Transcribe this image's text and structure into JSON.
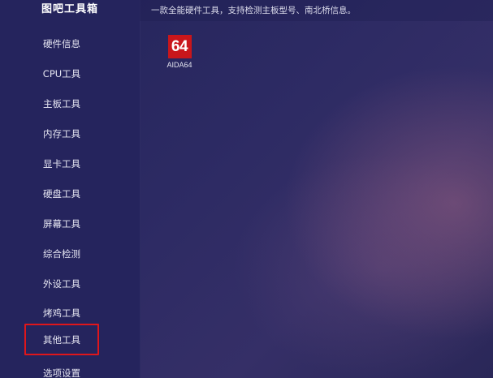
{
  "app": {
    "title": "图吧工具箱"
  },
  "header": {
    "description": "一款全能硬件工具，支持检测主板型号、南北桥信息。"
  },
  "sidebar": {
    "items": [
      {
        "label": "硬件信息"
      },
      {
        "label": "CPU工具"
      },
      {
        "label": "主板工具"
      },
      {
        "label": "内存工具"
      },
      {
        "label": "显卡工具"
      },
      {
        "label": "硬盘工具"
      },
      {
        "label": "屏幕工具"
      },
      {
        "label": "综合检测"
      },
      {
        "label": "外设工具"
      },
      {
        "label": "烤鸡工具"
      },
      {
        "label": "其他工具",
        "highlighted": true
      },
      {
        "label": "选项设置"
      }
    ]
  },
  "tools": [
    {
      "icon_text": "64",
      "label": "AIDA64",
      "icon": "aida64-icon",
      "icon_color": "#c9161b"
    }
  ],
  "colors": {
    "sidebar_bg": "#25245d",
    "highlight_border": "#e0161b",
    "text": "#e6e6f2"
  }
}
